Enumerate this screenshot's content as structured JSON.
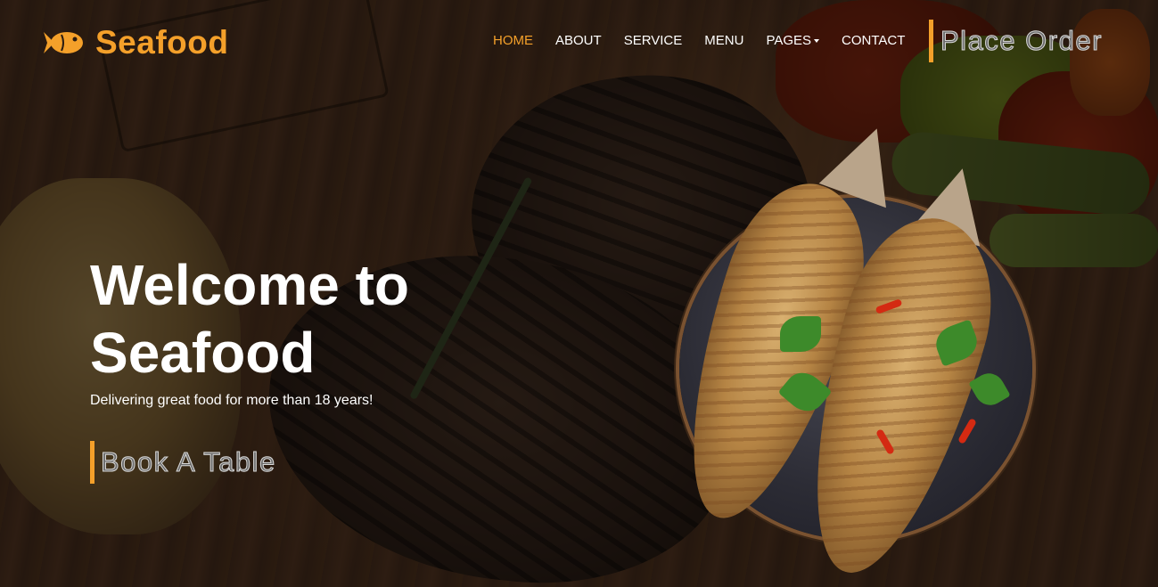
{
  "brand": {
    "name": "Seafood",
    "icon": "fish-icon",
    "accent_color": "#f4a02a"
  },
  "nav": {
    "items": [
      {
        "label": "HOME",
        "active": true
      },
      {
        "label": "ABOUT",
        "active": false
      },
      {
        "label": "SERVICE",
        "active": false
      },
      {
        "label": "MENU",
        "active": false
      },
      {
        "label": "PAGES",
        "active": false,
        "dropdown": true
      },
      {
        "label": "CONTACT",
        "active": false
      }
    ],
    "cta_label": "Place Order"
  },
  "hero": {
    "title": "Welcome to Seafood",
    "subtitle": "Delivering great food for more than 18 years!",
    "cta_label": "Book A Table"
  }
}
